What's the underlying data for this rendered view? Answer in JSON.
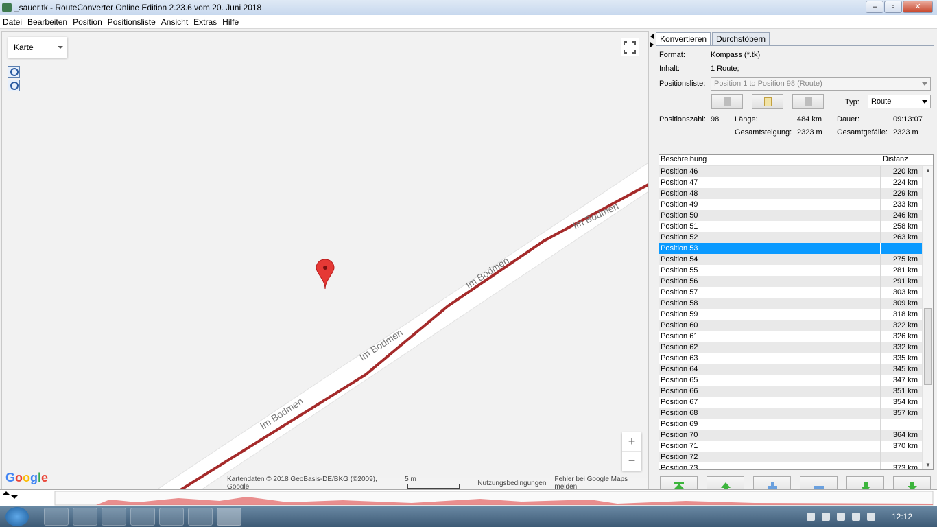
{
  "window": {
    "title": "_sauer.tk - RouteConverter Online Edition 2.23.6 vom 20. Juni 2018"
  },
  "menu": [
    "Datei",
    "Bearbeiten",
    "Position",
    "Positionsliste",
    "Ansicht",
    "Extras",
    "Hilfe"
  ],
  "map": {
    "type_selector": "Karte",
    "road_name": "Im Bodmen",
    "zoom_in": "+",
    "zoom_out": "−",
    "logo": "Google",
    "attribution": "Kartendaten © 2018 GeoBasis-DE/BKG (©2009), Google",
    "scale": "5 m",
    "terms": "Nutzungsbedingungen",
    "report": "Fehler bei Google Maps melden"
  },
  "tabs": [
    "Konvertieren",
    "Durchstöbern"
  ],
  "convert": {
    "format_label": "Format:",
    "format_value": "Kompass (*.tk)",
    "content_label": "Inhalt:",
    "content_value": "1 Route;",
    "poslist_label": "Positionsliste:",
    "poslist_value": "Position 1 to Position 98 (Route)",
    "type_label": "Typ:",
    "type_value": "Route",
    "count_label": "Positionszahl:",
    "count_value": "98",
    "length_label": "Länge:",
    "length_value": "484 km",
    "duration_label": "Dauer:",
    "duration_value": "09:13:07",
    "ascent_label": "Gesamtsteigung:",
    "ascent_value": "2323 m",
    "descent_label": "Gesamtgefälle:",
    "descent_value": "2323 m"
  },
  "table": {
    "headers": [
      "Beschreibung",
      "Distanz"
    ],
    "rows": [
      [
        "Position 46",
        "220 km"
      ],
      [
        "Position 47",
        "224 km"
      ],
      [
        "Position 48",
        "229 km"
      ],
      [
        "Position 49",
        "233 km"
      ],
      [
        "Position 50",
        "246 km"
      ],
      [
        "Position 51",
        "258 km"
      ],
      [
        "Position 52",
        "263 km"
      ],
      [
        "Position 53",
        ""
      ],
      [
        "Position 54",
        "275 km"
      ],
      [
        "Position 55",
        "281 km"
      ],
      [
        "Position 56",
        "291 km"
      ],
      [
        "Position 57",
        "303 km"
      ],
      [
        "Position 58",
        "309 km"
      ],
      [
        "Position 59",
        "318 km"
      ],
      [
        "Position 60",
        "322 km"
      ],
      [
        "Position 61",
        "326 km"
      ],
      [
        "Position 62",
        "332 km"
      ],
      [
        "Position 63",
        "335 km"
      ],
      [
        "Position 64",
        "345 km"
      ],
      [
        "Position 65",
        "347 km"
      ],
      [
        "Position 66",
        "351 km"
      ],
      [
        "Position 67",
        "354 km"
      ],
      [
        "Position 68",
        "357 km"
      ],
      [
        "Position 69",
        ""
      ],
      [
        "Position 70",
        "364 km"
      ],
      [
        "Position 71",
        "370 km"
      ],
      [
        "Position 72",
        ""
      ],
      [
        "Position 73",
        "373 km"
      ]
    ],
    "selected_row": "Position 53"
  },
  "taskbar": {
    "clock": "12:12"
  },
  "colors": {
    "route": "#a52a2a",
    "selection": "#0a9aff",
    "marker": "#e53935",
    "nav_icon": "#3cb43c"
  },
  "icons": {
    "nav": [
      "move-top-icon",
      "move-up-icon",
      "add-icon",
      "remove-icon",
      "move-down-icon",
      "move-bottom-icon"
    ]
  }
}
